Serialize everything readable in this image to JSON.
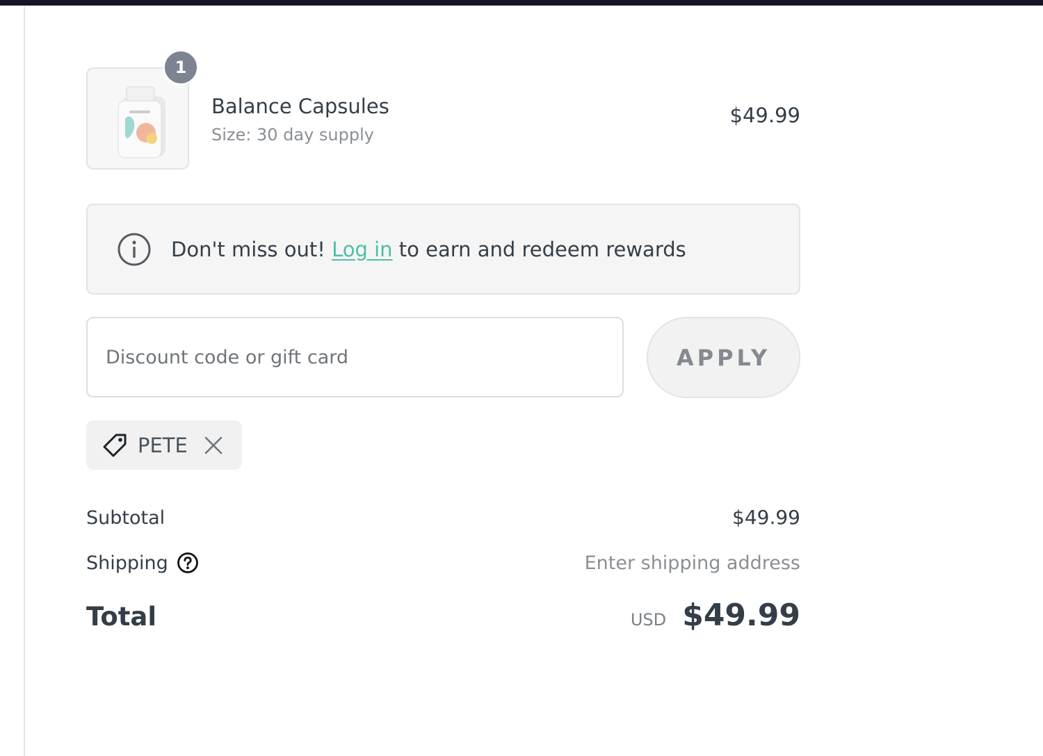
{
  "product": {
    "quantity": "1",
    "name": "Balance Capsules",
    "variant": "Size: 30 day supply",
    "price": "$49.99",
    "thumbnail_icon": "supplement-bottle-image"
  },
  "rewards": {
    "prefix": "Don't miss out!",
    "link_text": "Log in",
    "suffix": "to earn and redeem rewards",
    "icon": "info-icon",
    "link_color": "#4ebfa6"
  },
  "discount": {
    "placeholder": "Discount code or gift card",
    "value": "",
    "apply_label": "APPLY"
  },
  "applied_code": {
    "code": "PETE",
    "icon": "tag-icon",
    "remove_icon": "close-icon"
  },
  "totals": {
    "subtotal_label": "Subtotal",
    "subtotal_value": "$49.99",
    "shipping_label": "Shipping",
    "shipping_value": "Enter shipping address",
    "total_label": "Total",
    "currency": "USD",
    "total_value": "$49.99"
  }
}
